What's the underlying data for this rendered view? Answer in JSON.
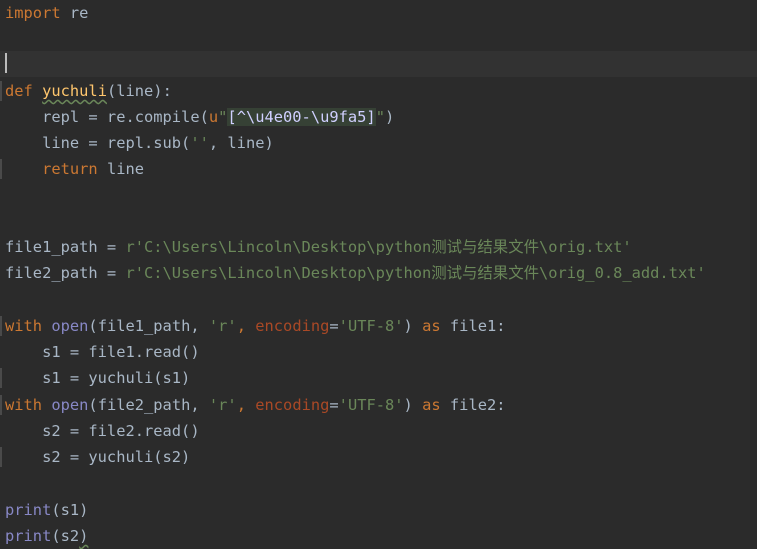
{
  "editor": {
    "language": "python",
    "theme_colors": {
      "background": "#2b2b2b",
      "current_line": "#323232",
      "keyword": "#cc7832",
      "builtin": "#8888c6",
      "function_def": "#ffc66d",
      "string": "#6a8759",
      "kwarg": "#aa4926",
      "text": "#a9b7c6"
    },
    "lines": {
      "l1_import": "import",
      "l1_mod": " re",
      "l4_def": "def",
      "l4_name": "yuchuli",
      "l4_rest": "(line):",
      "l5_pre": "    repl = re.compile(",
      "l5_u": "u",
      "l5_q1": "\"",
      "l5_regex": "[^\\u4e00-\\u9fa5]",
      "l5_q2": "\"",
      "l5_end": ")",
      "l6_pre": "    line = repl.sub(",
      "l6_str": "''",
      "l6_end": ", line)",
      "l7_ret": "    return",
      "l7_end": " line",
      "l10_var": "file1_path = ",
      "l10_str": "r'C:\\Users\\Lincoln\\Desktop\\python测试与结果文件\\orig.txt'",
      "l11_var": "file2_path = ",
      "l11_str": "r'C:\\Users\\Lincoln\\Desktop\\python测试与结果文件\\orig_0.8_add.txt'",
      "l13_with": "with",
      "l13_open": " open",
      "l13_a": "(file1_path, ",
      "l13_mode": "'r'",
      "l13_b": ", ",
      "l13_enc": "encoding",
      "l13_eq": "=",
      "l13_encval": "'UTF-8'",
      "l13_c": ") ",
      "l13_as": "as",
      "l13_d": " file1:",
      "l14": "    s1 = file1.read()",
      "l15": "    s1 = yuchuli(s1)",
      "l16_with": "with",
      "l16_open": " open",
      "l16_a": "(file2_path, ",
      "l16_mode": "'r'",
      "l16_b": ", ",
      "l16_enc": "encoding",
      "l16_eq": "=",
      "l16_encval": "'UTF-8'",
      "l16_c": ") ",
      "l16_as": "as",
      "l16_d": " file2:",
      "l17": "    s2 = file2.read()",
      "l18": "    s2 = yuchuli(s2)",
      "l20_print": "print",
      "l20_rest": "(s1)",
      "l21_print": "print",
      "l21_rest": "(s2",
      "l21_close": ")"
    }
  }
}
